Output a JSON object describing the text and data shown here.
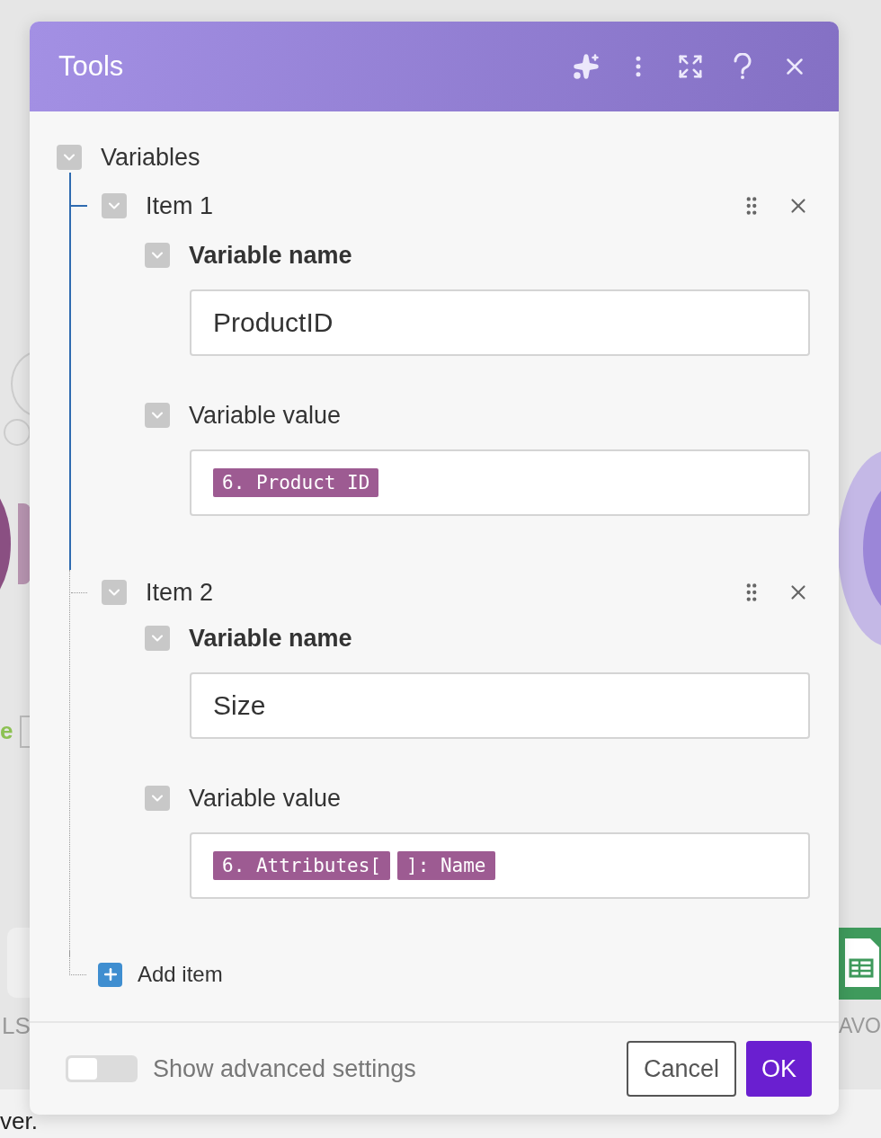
{
  "dialog": {
    "title": "Tools",
    "root": {
      "label": "Variables",
      "expanded": true
    },
    "items": [
      {
        "label": "Item 1",
        "expanded": true,
        "highlighted": true,
        "fields": [
          {
            "label": "Variable name",
            "required": true,
            "expanded": true,
            "value": "ProductID"
          },
          {
            "label": "Variable value",
            "required": false,
            "expanded": true,
            "tokens": [
              "6. Product ID"
            ]
          }
        ]
      },
      {
        "label": "Item 2",
        "expanded": true,
        "highlighted": false,
        "fields": [
          {
            "label": "Variable name",
            "required": true,
            "expanded": true,
            "value": "Size"
          },
          {
            "label": "Variable value",
            "required": false,
            "expanded": true,
            "tokens": [
              "6. Attributes[",
              "]: Name"
            ]
          }
        ]
      }
    ],
    "add_item": "Add item",
    "footer": {
      "advanced_toggle": {
        "label": "Show advanced settings",
        "on": false
      },
      "buttons": [
        {
          "label": "Cancel",
          "kind": "secondary"
        },
        {
          "label": "OK",
          "kind": "primary"
        }
      ]
    }
  },
  "background": {
    "fragments": [
      {
        "text": "e"
      },
      {
        "text": "LS"
      },
      {
        "text": "AVO"
      },
      {
        "text": "ver."
      }
    ]
  }
}
